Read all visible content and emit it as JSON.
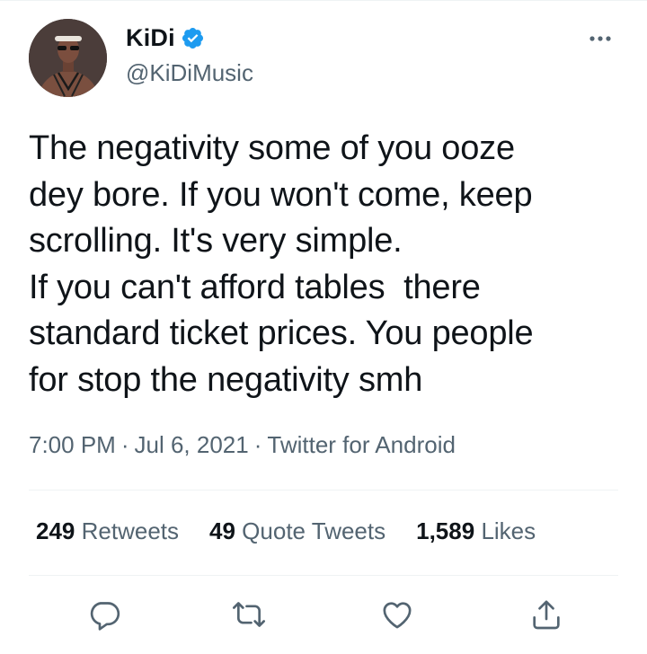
{
  "user": {
    "display_name": "KiDi",
    "handle": "@KiDiMusic",
    "verified": true
  },
  "tweet": {
    "text_lines": [
      "The negativity some of you ooze",
      "dey bore. If you won't come, keep",
      "scrolling. It's very simple.",
      "If you can't afford tables  there",
      "standard ticket prices. You people",
      "for stop the negativity smh"
    ],
    "time": "7:00 PM",
    "date": "Jul 6, 2021",
    "source": "Twitter for Android",
    "separator": "·"
  },
  "stats": {
    "retweets_count": "249",
    "retweets_label": "Retweets",
    "quotes_count": "49",
    "quotes_label": "Quote Tweets",
    "likes_count": "1,589",
    "likes_label": "Likes"
  },
  "icons": {
    "more": "more-icon",
    "reply": "reply-icon",
    "retweet": "retweet-icon",
    "like": "heart-icon",
    "share": "share-icon",
    "verified": "verified-badge-icon"
  },
  "colors": {
    "text": "#0f1419",
    "secondary": "#536471",
    "verified": "#1d9bf0",
    "divider": "#eff3f4"
  }
}
